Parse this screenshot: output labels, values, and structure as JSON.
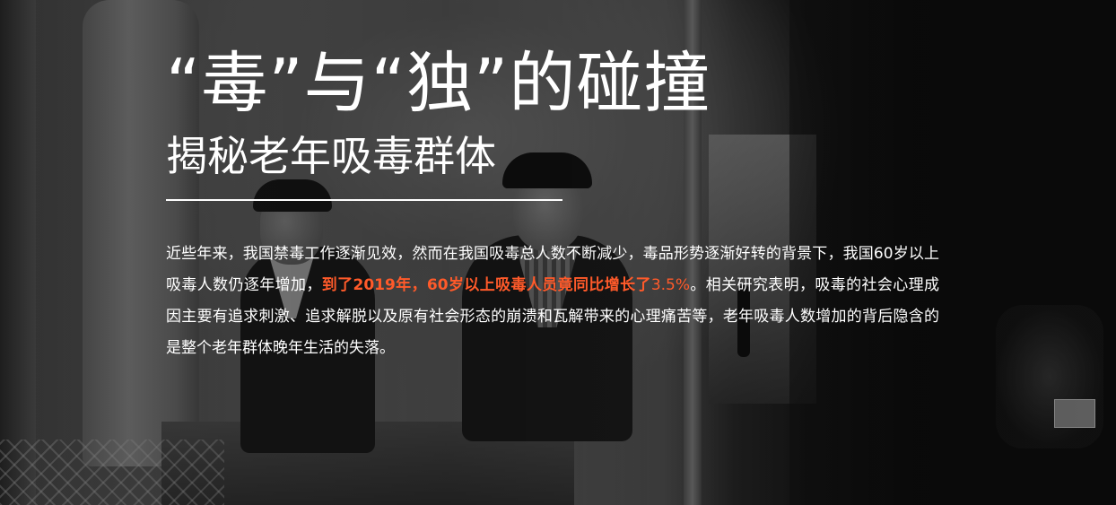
{
  "headline": {
    "title": "“毒”与“独”的碰撞",
    "subtitle": "揭秘老年吸毒群体"
  },
  "article": {
    "para_part1": "近些年来，我国禁毒工作逐渐见效，然而在我国吸毒总人数不断减少，毒品形势逐渐好转的背景下，我国60岁以上吸毒人数仍逐年增加，",
    "highlight": "到了2019年，60岁以上吸毒人员竟同比增长了",
    "highlight_value": "3.5%",
    "para_part2": "。相关研究表明，吸毒的社会心理成因主要有追求刺激、追求解脱以及原有社会形态的崩溃和瓦解带来的心理痛苦等，老年吸毒人数增加的背后隐含的是整个老年群体晚年生活的失落。"
  },
  "colors": {
    "highlight": "#ff5a2a",
    "text": "#ffffff",
    "background": "#0d0d0d"
  }
}
